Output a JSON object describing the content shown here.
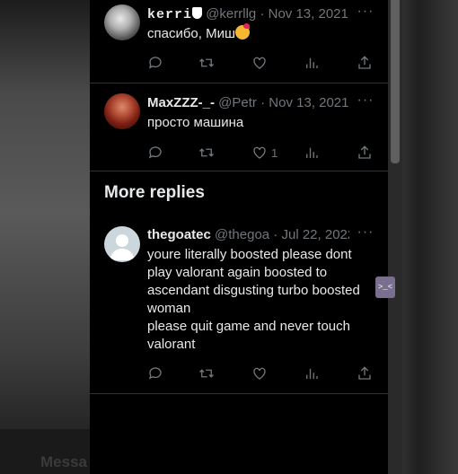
{
  "background": {
    "bottom_left_text": "Messa"
  },
  "replies": [
    {
      "name": "kerri",
      "handle": "@kerrllg",
      "sep": "·",
      "date": "Nov 13, 2021",
      "text": "спасибо, Миш",
      "reply_count": "",
      "retweet_count": "",
      "like_count": "",
      "view_count": ""
    },
    {
      "name": "MaxZZZ-_-",
      "handle": "@Petr",
      "sep": "·",
      "date": "Nov 13, 2021",
      "text": "просто машина",
      "reply_count": "",
      "retweet_count": "",
      "like_count": "1",
      "view_count": ""
    }
  ],
  "more_replies": {
    "title": "More replies",
    "items": [
      {
        "name": "thegoatec",
        "handle": "@thegoa",
        "sep": "·",
        "date": "Jul 22, 2022",
        "text_lines": [
          "youre literally boosted please dont",
          "play valorant again boosted to",
          "ascendant disgusting turbo boosted",
          "woman",
          "please quit game and never touch",
          "valorant"
        ]
      }
    ]
  },
  "side_badge": {
    "text": ">_<"
  },
  "colors": {
    "text": "#e7e9ea",
    "muted": "#71767b",
    "border": "#2f3336",
    "background": "#000000"
  },
  "icons": [
    "more-icon",
    "reply-icon",
    "retweet-icon",
    "like-icon",
    "views-icon",
    "share-icon"
  ]
}
